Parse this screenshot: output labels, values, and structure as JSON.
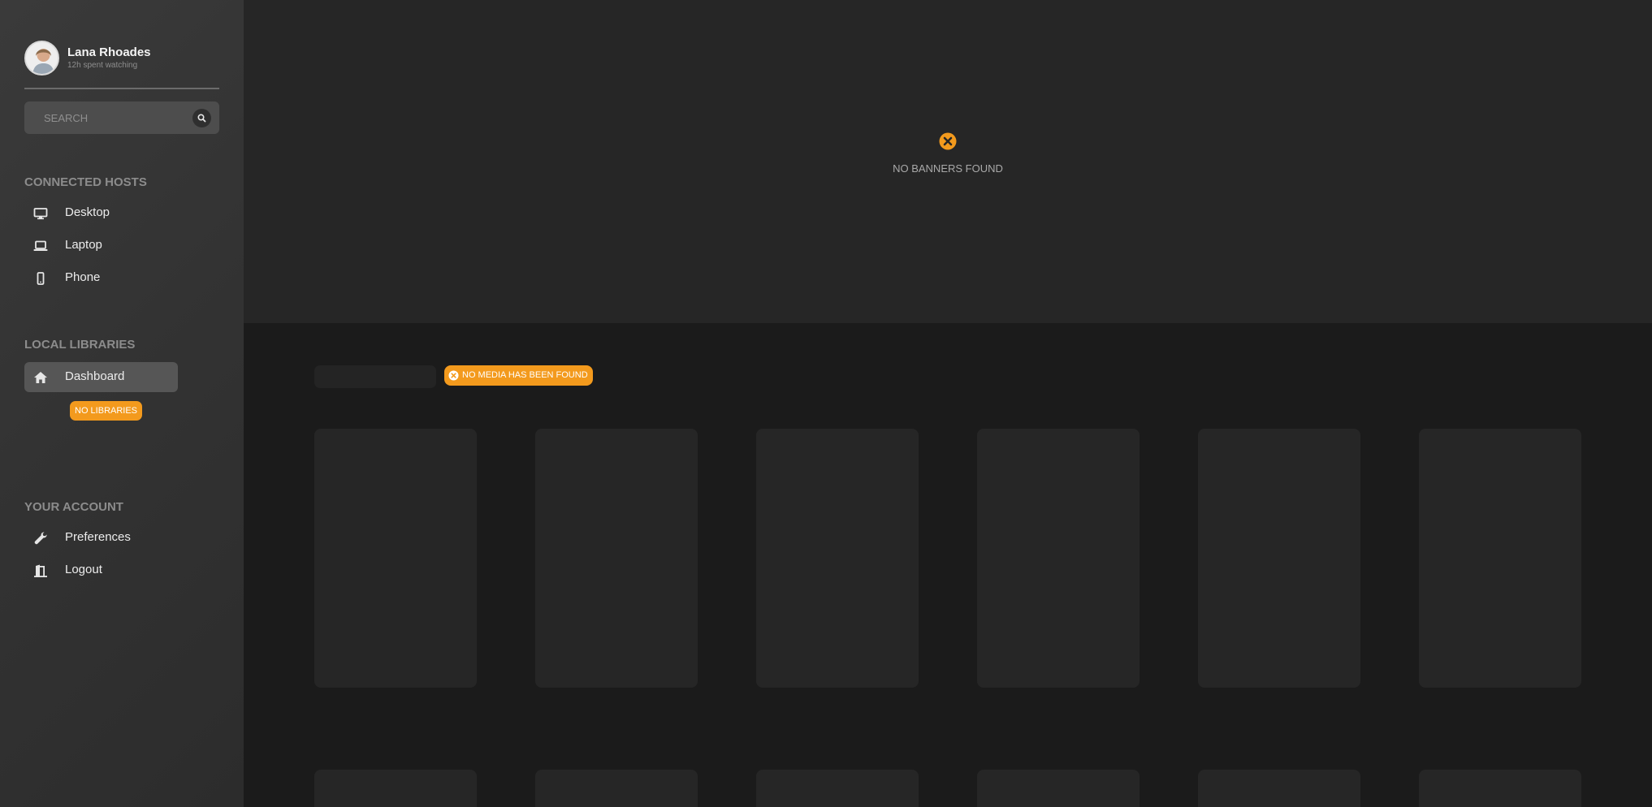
{
  "user": {
    "name": "Lana Rhoades",
    "subtitle": "12h spent watching"
  },
  "search": {
    "placeholder": "SEARCH"
  },
  "sections": {
    "connected_hosts": "CONNECTED HOSTS",
    "local_libraries": "LOCAL LIBRARIES",
    "your_account": "YOUR ACCOUNT"
  },
  "hosts": [
    {
      "label": "Desktop",
      "icon": "desktop-icon"
    },
    {
      "label": "Laptop",
      "icon": "laptop-icon"
    },
    {
      "label": "Phone",
      "icon": "phone-icon"
    }
  ],
  "libraries": {
    "dashboard_label": "Dashboard",
    "dashboard_icon": "home-icon",
    "empty_badge": "NO LIBRARIES"
  },
  "account": [
    {
      "label": "Preferences",
      "icon": "wrench-icon"
    },
    {
      "label": "Logout",
      "icon": "door-exit-icon"
    }
  ],
  "banner": {
    "empty_text": "NO BANNERS FOUND",
    "icon": "close-circle-icon"
  },
  "media": {
    "empty_badge": "NO MEDIA HAS BEEN FOUND"
  },
  "colors": {
    "accent": "#f39a1d",
    "sidebar": "#363636",
    "banner_bg": "#262626",
    "page_bg": "#1b1b1b"
  }
}
